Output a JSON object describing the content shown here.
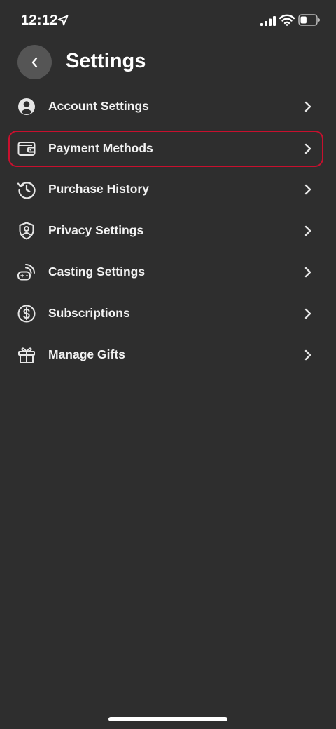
{
  "status_bar": {
    "time": "12:12",
    "icons": [
      "location-arrow-icon",
      "cellular-signal-icon",
      "wifi-icon",
      "battery-icon"
    ],
    "battery_level_percent": 40
  },
  "header": {
    "back_icon": "chevron-left-icon",
    "title": "Settings"
  },
  "menu": {
    "items": [
      {
        "label": "Account Settings",
        "icon": "person-circle-icon",
        "highlighted": false
      },
      {
        "label": "Payment Methods",
        "icon": "wallet-icon",
        "highlighted": true
      },
      {
        "label": "Purchase History",
        "icon": "history-clock-icon",
        "highlighted": false
      },
      {
        "label": "Privacy Settings",
        "icon": "shield-person-icon",
        "highlighted": false
      },
      {
        "label": "Casting Settings",
        "icon": "cast-gamepad-icon",
        "highlighted": false
      },
      {
        "label": "Subscriptions",
        "icon": "dollar-circle-icon",
        "highlighted": false
      },
      {
        "label": "Manage Gifts",
        "icon": "gift-icon",
        "highlighted": false
      }
    ]
  },
  "colors": {
    "background": "#2e2e2e",
    "text": "#ffffff",
    "highlight_border": "#c8102e",
    "back_button_bg": "#555555"
  }
}
